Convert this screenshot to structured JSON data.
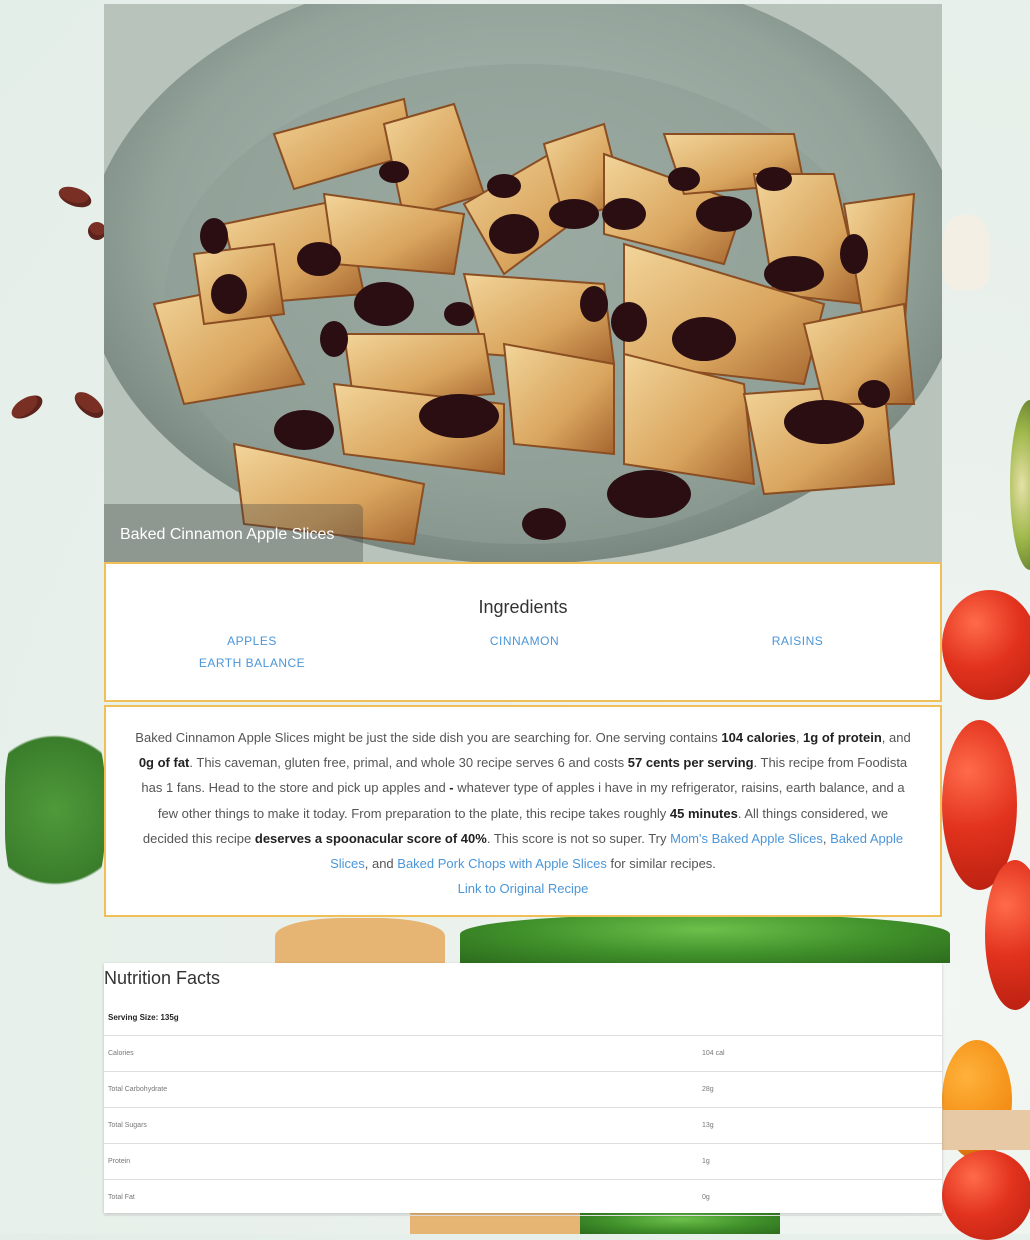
{
  "recipe": {
    "title": "Baked Cinnamon Apple Slices"
  },
  "ingredients": {
    "heading": "Ingredients",
    "items": [
      "APPLES",
      "CINNAMON",
      "RAISINS",
      "EARTH BALANCE"
    ]
  },
  "summary": {
    "t1": "Baked Cinnamon Apple Slices might be just the side dish you are searching for. One serving contains ",
    "calories": "104 calories",
    "t2": ", ",
    "protein": "1g of protein",
    "t3": ", and ",
    "fat": "0g of fat",
    "t4": ". This caveman, gluten free, primal, and whole 30 recipe serves 6 and costs ",
    "cost": "57 cents per serving",
    "t5": ". This recipe from Foodista has 1 fans. Head to the store and pick up apples and ",
    "dash": "-",
    "t6": " whatever type of apples i have in my refrigerator, raisins, earth balance, and a few other things to make it today. From preparation to the plate, this recipe takes roughly ",
    "time": "45 minutes",
    "t7": ". All things considered, we decided this recipe ",
    "score": "deserves a spoonacular score of 40%",
    "t8": ". This score is not so super. Try ",
    "link1": "Mom's Baked Apple Slices",
    "t9": ", ",
    "link2": "Baked Apple Slices",
    "t10": ", and ",
    "link3": "Baked Pork Chops with Apple Slices",
    "t11": " for similar recipes.",
    "original_link": "Link to Original Recipe"
  },
  "nutrition": {
    "heading": "Nutrition Facts",
    "serving": "Serving Size: 135g",
    "rows": [
      {
        "label": "Calories",
        "value": "104 cal"
      },
      {
        "label": "Total Carbohydrate",
        "value": "28g"
      },
      {
        "label": "Total Sugars",
        "value": "13g"
      },
      {
        "label": "Protein",
        "value": "1g"
      },
      {
        "label": "Total Fat",
        "value": "0g"
      }
    ]
  }
}
